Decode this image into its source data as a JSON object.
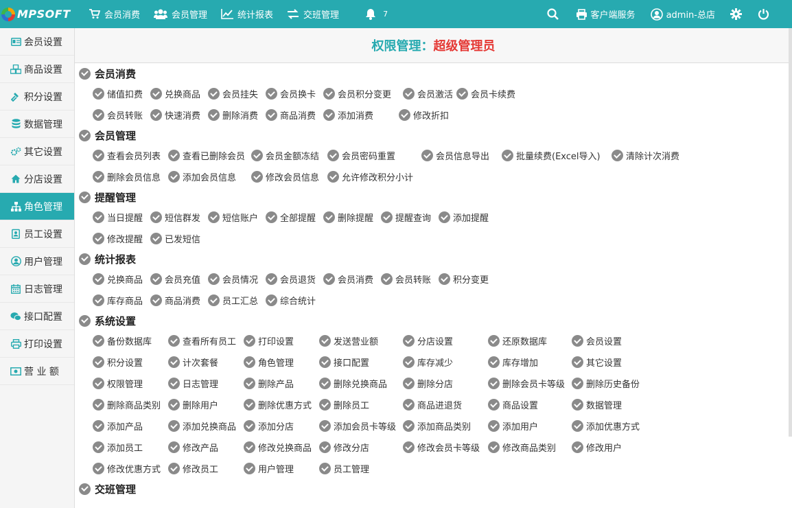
{
  "logo": {
    "text": "MPSOFT"
  },
  "nav": [
    {
      "label": "会员消费",
      "icon": "cart-icon"
    },
    {
      "label": "会员管理",
      "icon": "users-icon"
    },
    {
      "label": "统计报表",
      "icon": "line-chart-icon"
    },
    {
      "label": "交班管理",
      "icon": "exchange-icon"
    }
  ],
  "notifications": {
    "count": "7",
    "icon": "bell-icon"
  },
  "topright": {
    "service_label": "客户端服务",
    "user_label": "admin-总店"
  },
  "sidebar": [
    {
      "label": "会员设置",
      "icon": "id-card-icon",
      "active": false
    },
    {
      "label": "商品设置",
      "icon": "cubes-icon",
      "active": false
    },
    {
      "label": "积分设置",
      "icon": "gavel-icon",
      "active": false
    },
    {
      "label": "数据管理",
      "icon": "database-icon",
      "active": false
    },
    {
      "label": "其它设置",
      "icon": "cogs-icon",
      "active": false
    },
    {
      "label": "分店设置",
      "icon": "home-icon",
      "active": false
    },
    {
      "label": "角色管理",
      "icon": "sitemap-icon",
      "active": true
    },
    {
      "label": "员工设置",
      "icon": "badge-icon",
      "active": false
    },
    {
      "label": "用户管理",
      "icon": "user-circle-icon",
      "active": false
    },
    {
      "label": "日志管理",
      "icon": "calendar-icon",
      "active": false
    },
    {
      "label": "接口配置",
      "icon": "wechat-icon",
      "active": false
    },
    {
      "label": "打印设置",
      "icon": "print-icon",
      "active": false
    },
    {
      "label": "营 业 额",
      "icon": "money-icon",
      "active": false
    }
  ],
  "page": {
    "title_label": "权限管理：",
    "title_role": "超级管理员"
  },
  "groups": [
    {
      "title": "会员消费",
      "rows": [
        [
          "储值扣费",
          "兑换商品",
          "会员挂失",
          "会员换卡",
          "会员积分变更",
          "会员激活",
          "会员卡续费"
        ],
        [
          "会员转账",
          "快速消费",
          "删除消费",
          "商品消费",
          "添加消费",
          "修改折扣"
        ]
      ]
    },
    {
      "title": "会员管理",
      "rows": [
        [
          "查看会员列表",
          "查看已删除会员",
          "会员金额冻结",
          "会员密码重置",
          "会员信息导出",
          "批量续费(Excel导入)",
          "清除计次消费"
        ],
        [
          "删除会员信息",
          "添加会员信息",
          "修改会员信息",
          "允许修改积分小计"
        ]
      ]
    },
    {
      "title": "提醒管理",
      "rows": [
        [
          "当日提醒",
          "短信群发",
          "短信账户",
          "全部提醒",
          "删除提醒",
          "提醒查询",
          "添加提醒"
        ],
        [
          "修改提醒",
          "已发短信"
        ]
      ]
    },
    {
      "title": "统计报表",
      "rows": [
        [
          "兑换商品",
          "会员充值",
          "会员情况",
          "会员退货",
          "会员消费",
          "会员转账",
          "积分变更"
        ],
        [
          "库存商品",
          "商品消费",
          "员工汇总",
          "综合统计"
        ]
      ]
    },
    {
      "title": "系统设置",
      "rows": [
        [
          "备份数据库",
          "查看所有员工",
          "打印设置",
          "发送营业额",
          "分店设置",
          "还原数据库",
          "会员设置"
        ],
        [
          "积分设置",
          "计次套餐",
          "角色管理",
          "接口配置",
          "库存减少",
          "库存增加",
          "其它设置"
        ],
        [
          "权限管理",
          "日志管理",
          "删除产品",
          "删除兑换商品",
          "删除分店",
          "删除会员卡等级",
          "删除历史备份"
        ],
        [
          "删除商品类别",
          "删除用户",
          "删除优惠方式",
          "删除员工",
          "商品进退货",
          "商品设置",
          "数据管理"
        ],
        [
          "添加产品",
          "添加兑换商品",
          "添加分店",
          "添加会员卡等级",
          "添加商品类别",
          "添加用户",
          "添加优惠方式"
        ],
        [
          "添加员工",
          "修改产品",
          "修改兑换商品",
          "修改分店",
          "修改会员卡等级",
          "修改商品类别",
          "修改用户"
        ],
        [
          "修改优惠方式",
          "修改员工",
          "用户管理",
          "员工管理"
        ]
      ]
    },
    {
      "title": "交班管理",
      "rows": []
    }
  ]
}
